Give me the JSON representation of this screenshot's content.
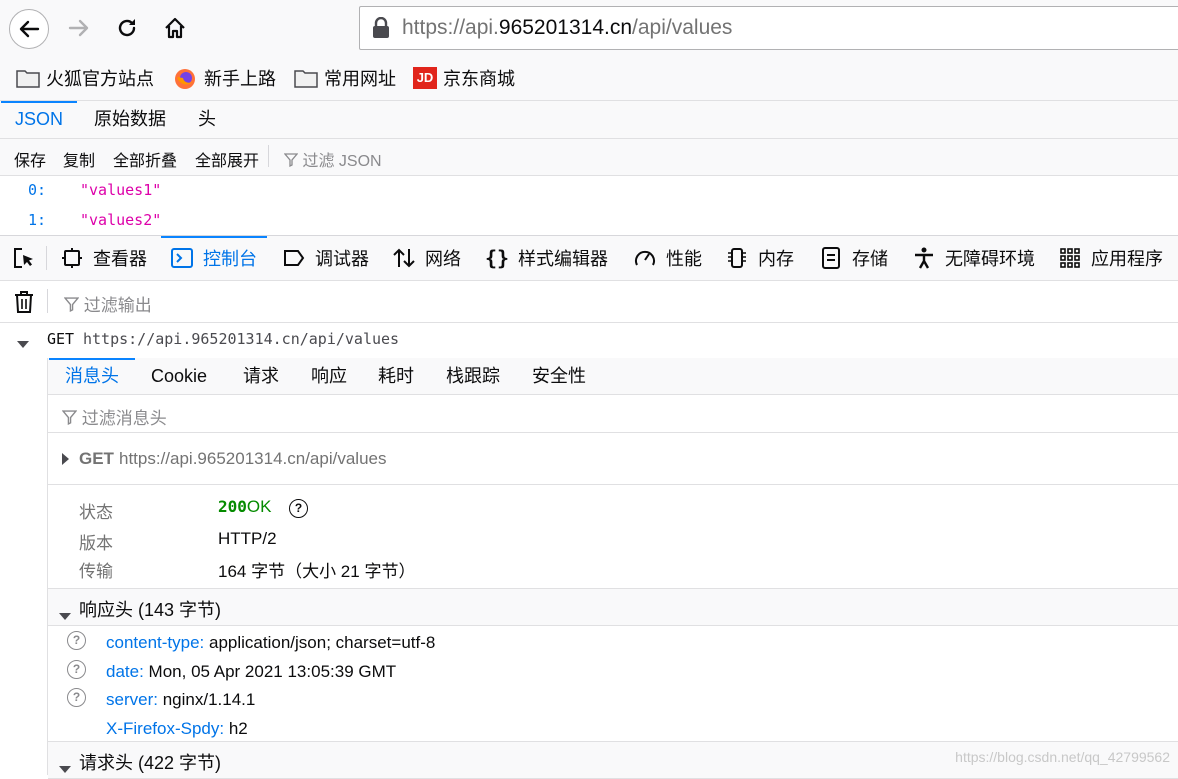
{
  "browser": {
    "url_prefix": "https://api.",
    "url_domain": "965201314.cn",
    "url_path": "/api/values",
    "bookmarks": [
      {
        "label": "火狐官方站点",
        "icon": "folder-icon"
      },
      {
        "label": "新手上路",
        "icon": "firefox-icon"
      },
      {
        "label": "常用网址",
        "icon": "folder-icon"
      },
      {
        "label": "京东商城",
        "icon": "jd-icon"
      }
    ],
    "jd_icon_text": "JD"
  },
  "json_viewer": {
    "tabs": [
      "JSON",
      "原始数据",
      "头"
    ],
    "toolbar": [
      "保存",
      "复制",
      "全部折叠",
      "全部展开"
    ],
    "filter_placeholder": "过滤 JSON",
    "rows": [
      {
        "key": "0:",
        "value": "\"values1\""
      },
      {
        "key": "1:",
        "value": "\"values2\""
      }
    ]
  },
  "devtools": {
    "tabs": [
      {
        "label": "查看器",
        "icon": "inspector-icon"
      },
      {
        "label": "控制台",
        "icon": "console-icon",
        "selected": true
      },
      {
        "label": "调试器",
        "icon": "debugger-icon"
      },
      {
        "label": "网络",
        "icon": "network-icon"
      },
      {
        "label": "样式编辑器",
        "icon": "style-editor-icon"
      },
      {
        "label": "性能",
        "icon": "performance-icon"
      },
      {
        "label": "内存",
        "icon": "memory-icon"
      },
      {
        "label": "存储",
        "icon": "storage-icon"
      },
      {
        "label": "无障碍环境",
        "icon": "accessibility-icon"
      },
      {
        "label": "应用程序",
        "icon": "application-icon"
      }
    ],
    "console_filter": "过滤输出",
    "request": {
      "method": "GET",
      "url": "https://api.965201314.cn/api/values"
    },
    "subtabs": [
      "消息头",
      "Cookie",
      "请求",
      "响应",
      "耗时",
      "栈跟踪",
      "安全性"
    ],
    "headers_filter": "过滤消息头",
    "summary": {
      "method": "GET",
      "url": "https://api.965201314.cn/api/values"
    },
    "status": {
      "status_label": "状态",
      "status_code": "200",
      "status_text": "OK",
      "version_label": "版本",
      "version": "HTTP/2",
      "transfer_label": "传输",
      "transfer": "164 字节（大小 21 字节）"
    },
    "response_headers_title": "响应头 (143 字节)",
    "response_headers": [
      {
        "name": "content-type:",
        "value": "application/json; charset=utf-8",
        "help": true
      },
      {
        "name": "date:",
        "value": "Mon, 05 Apr 2021 13:05:39 GMT",
        "help": true
      },
      {
        "name": "server:",
        "value": "nginx/1.14.1",
        "help": true
      },
      {
        "name": "X-Firefox-Spdy:",
        "value": "h2",
        "help": false
      }
    ],
    "request_headers_title": "请求头 (422 字节)"
  },
  "watermark": "https://blog.csdn.net/qq_42799562",
  "colors": {
    "accent": "#0a84ff",
    "link": "#0074e8",
    "json_string": "#dd00a9",
    "status_ok": "#058b00"
  }
}
